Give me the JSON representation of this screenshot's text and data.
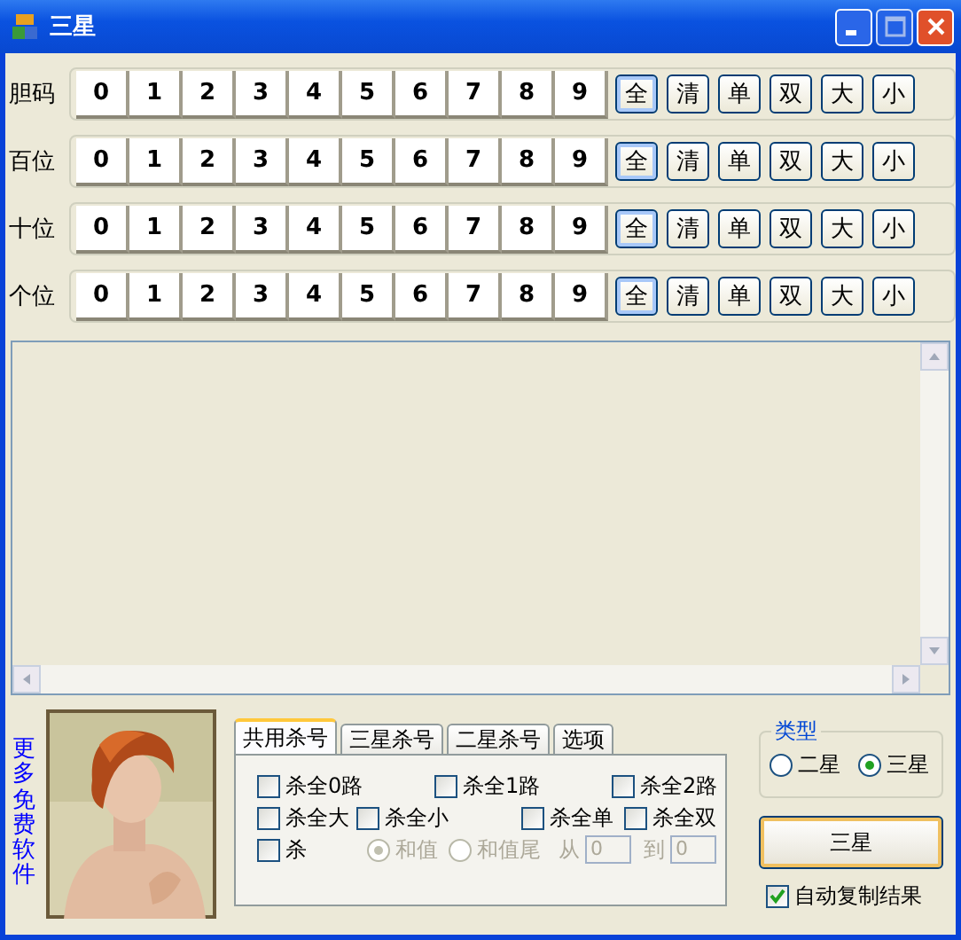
{
  "window": {
    "title": "三星"
  },
  "rows": [
    {
      "label": "胆码",
      "digits": [
        "0",
        "1",
        "2",
        "3",
        "4",
        "5",
        "6",
        "7",
        "8",
        "9"
      ],
      "actions": [
        {
          "label": "全",
          "focused": true
        },
        {
          "label": "清",
          "focused": false
        },
        {
          "label": "单",
          "focused": false
        },
        {
          "label": "双",
          "focused": false
        },
        {
          "label": "大",
          "focused": false
        },
        {
          "label": "小",
          "focused": false
        }
      ]
    },
    {
      "label": "百位",
      "digits": [
        "0",
        "1",
        "2",
        "3",
        "4",
        "5",
        "6",
        "7",
        "8",
        "9"
      ],
      "actions": [
        {
          "label": "全",
          "focused": true
        },
        {
          "label": "清",
          "focused": false
        },
        {
          "label": "单",
          "focused": false
        },
        {
          "label": "双",
          "focused": false
        },
        {
          "label": "大",
          "focused": false
        },
        {
          "label": "小",
          "focused": false
        }
      ]
    },
    {
      "label": "十位",
      "digits": [
        "0",
        "1",
        "2",
        "3",
        "4",
        "5",
        "6",
        "7",
        "8",
        "9"
      ],
      "actions": [
        {
          "label": "全",
          "focused": true
        },
        {
          "label": "清",
          "focused": false
        },
        {
          "label": "单",
          "focused": false
        },
        {
          "label": "双",
          "focused": false
        },
        {
          "label": "大",
          "focused": false
        },
        {
          "label": "小",
          "focused": false
        }
      ]
    },
    {
      "label": "个位",
      "digits": [
        "0",
        "1",
        "2",
        "3",
        "4",
        "5",
        "6",
        "7",
        "8",
        "9"
      ],
      "actions": [
        {
          "label": "全",
          "focused": true
        },
        {
          "label": "清",
          "focused": false
        },
        {
          "label": "单",
          "focused": false
        },
        {
          "label": "双",
          "focused": false
        },
        {
          "label": "大",
          "focused": false
        },
        {
          "label": "小",
          "focused": false
        }
      ]
    }
  ],
  "more_link": "更多免费软件",
  "photo": {
    "kind": "picture"
  },
  "tabs": [
    {
      "label": "共用杀号",
      "selected": true
    },
    {
      "label": "三星杀号",
      "selected": false
    },
    {
      "label": "二星杀号",
      "selected": false
    },
    {
      "label": "选项",
      "selected": false
    }
  ],
  "kill_rows": [
    [
      {
        "kind": "checkbox",
        "label": "杀全0路",
        "checked": false
      },
      {
        "kind": "checkbox",
        "label": "杀全1路",
        "checked": false
      },
      {
        "kind": "checkbox",
        "label": "杀全2路",
        "checked": false
      }
    ],
    [
      {
        "kind": "checkbox",
        "label": "杀全大",
        "checked": false
      },
      {
        "kind": "checkbox",
        "label": "杀全小",
        "checked": false
      },
      {
        "kind": "checkbox",
        "label": "杀全单",
        "checked": false
      },
      {
        "kind": "checkbox",
        "label": "杀全双",
        "checked": false
      }
    ],
    [
      {
        "kind": "checkbox",
        "label": "杀",
        "checked": false
      },
      {
        "kind": "radio",
        "label": "和值",
        "selected": true,
        "disabled": true
      },
      {
        "kind": "radio",
        "label": "和值尾",
        "selected": false,
        "disabled": true
      },
      {
        "kind": "text",
        "label": "从",
        "disabled": true
      },
      {
        "kind": "field",
        "value": "0"
      },
      {
        "kind": "text",
        "label": "到",
        "disabled": true
      },
      {
        "kind": "field",
        "value": "0"
      }
    ]
  ],
  "type_group": {
    "title": "类型",
    "options": [
      {
        "label": "二星",
        "selected": false
      },
      {
        "label": "三星",
        "selected": true
      }
    ]
  },
  "run_button": "三星",
  "auto_copy": {
    "label": "自动复制结果",
    "checked": true
  }
}
